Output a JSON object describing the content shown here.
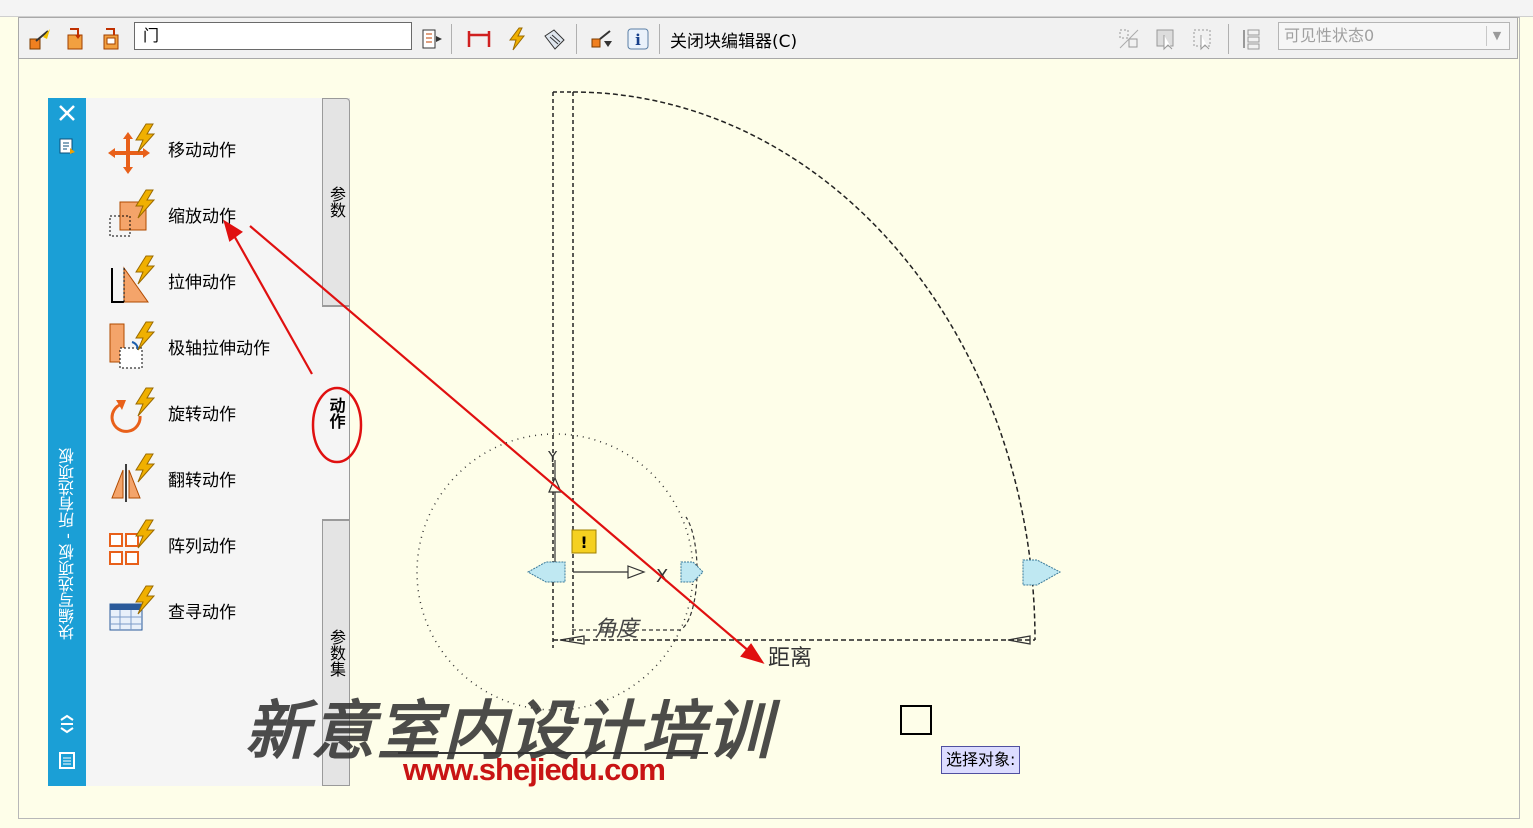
{
  "toolbar": {
    "block_name": "门",
    "close_editor": "关闭块编辑器(C)",
    "visibility_state": "可见性状态0"
  },
  "palette": {
    "title": "块编写选项板 - 所有选项板",
    "tabs": [
      "参数",
      "动作",
      "参数集"
    ],
    "tools": [
      {
        "label": "移动动作",
        "icon": "move-action-icon"
      },
      {
        "label": "缩放动作",
        "icon": "scale-action-icon"
      },
      {
        "label": "拉伸动作",
        "icon": "stretch-action-icon"
      },
      {
        "label": "极轴拉伸动作",
        "icon": "polar-stretch-action-icon"
      },
      {
        "label": "旋转动作",
        "icon": "rotate-action-icon"
      },
      {
        "label": "翻转动作",
        "icon": "flip-action-icon"
      },
      {
        "label": "阵列动作",
        "icon": "array-action-icon"
      },
      {
        "label": "查寻动作",
        "icon": "lookup-action-icon"
      }
    ]
  },
  "drawing": {
    "angle_label": "角度",
    "distance_label": "距离",
    "axis_x": "X",
    "axis_y": "Y",
    "prompt": "选择对象:"
  },
  "watermark": {
    "brand": "新意室内设计培训",
    "url": "www.shejiedu.com"
  },
  "colors": {
    "palette_strip": "#1b9fd6",
    "canvas_bg": "#fefee9",
    "annotation_red": "#e01010",
    "grip_fill": "#bfe8f2"
  }
}
